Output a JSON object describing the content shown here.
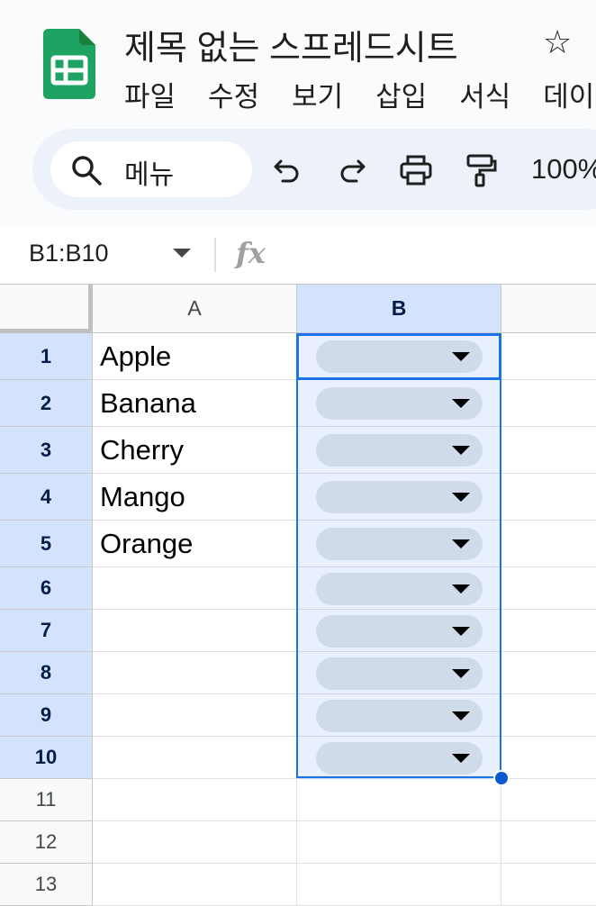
{
  "doc": {
    "title": "제목 없는 스프레드시트"
  },
  "menu": [
    "파일",
    "수정",
    "보기",
    "삽입",
    "서식",
    "데이터"
  ],
  "toolbar": {
    "search_label": "메뉴",
    "zoom": "100%"
  },
  "formula_bar": {
    "name_box": "B1:B10",
    "fx_label": "fx",
    "value": ""
  },
  "colors": {
    "selection": "#1a73e8",
    "selected_header": "#d3e3fd",
    "chip": "#d0dbe9"
  },
  "sheet": {
    "columns": [
      "A",
      "B"
    ],
    "rows": [
      {
        "num": "1",
        "a": "Apple"
      },
      {
        "num": "2",
        "a": "Banana"
      },
      {
        "num": "3",
        "a": "Cherry"
      },
      {
        "num": "4",
        "a": "Mango"
      },
      {
        "num": "5",
        "a": "Orange"
      },
      {
        "num": "6",
        "a": ""
      },
      {
        "num": "7",
        "a": ""
      },
      {
        "num": "8",
        "a": ""
      },
      {
        "num": "9",
        "a": ""
      },
      {
        "num": "10",
        "a": ""
      },
      {
        "num": "11",
        "a": ""
      },
      {
        "num": "12",
        "a": ""
      },
      {
        "num": "13",
        "a": ""
      }
    ],
    "selected_rows": [
      "1",
      "2",
      "3",
      "4",
      "5",
      "6",
      "7",
      "8",
      "9",
      "10"
    ]
  }
}
